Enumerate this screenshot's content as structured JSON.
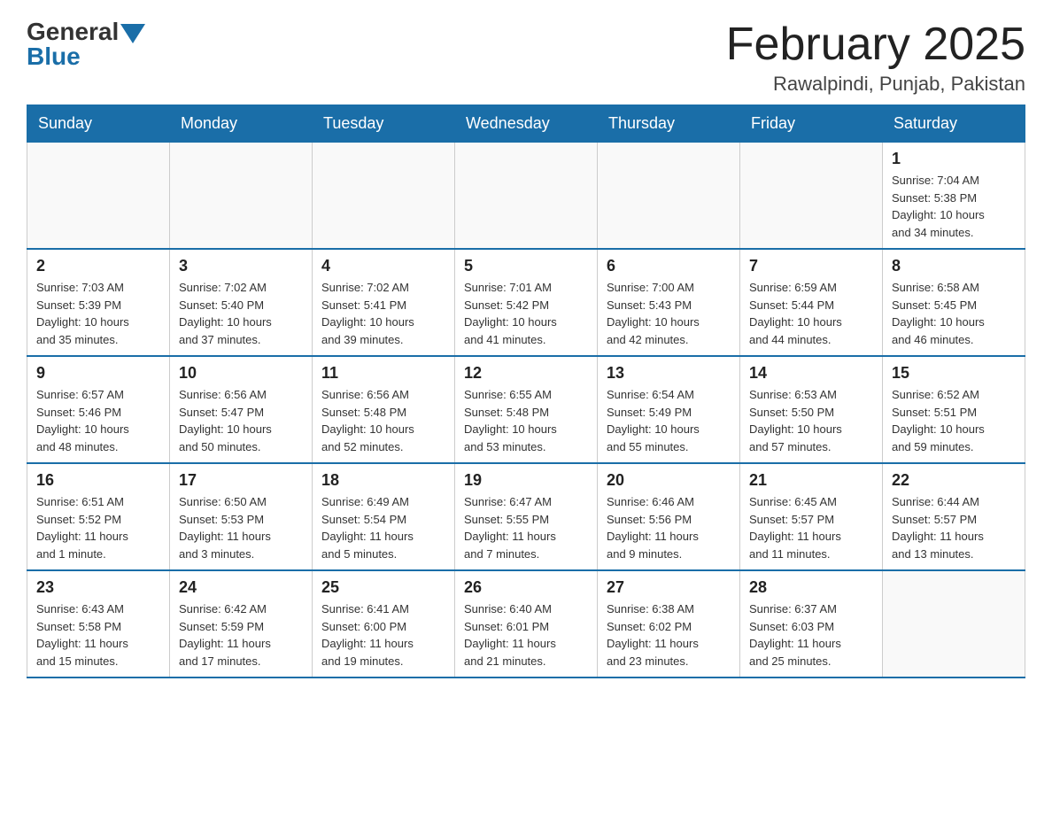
{
  "header": {
    "logo_general": "General",
    "logo_blue": "Blue",
    "month_title": "February 2025",
    "location": "Rawalpindi, Punjab, Pakistan"
  },
  "weekdays": [
    "Sunday",
    "Monday",
    "Tuesday",
    "Wednesday",
    "Thursday",
    "Friday",
    "Saturday"
  ],
  "rows": [
    [
      {
        "day": "",
        "info": ""
      },
      {
        "day": "",
        "info": ""
      },
      {
        "day": "",
        "info": ""
      },
      {
        "day": "",
        "info": ""
      },
      {
        "day": "",
        "info": ""
      },
      {
        "day": "",
        "info": ""
      },
      {
        "day": "1",
        "info": "Sunrise: 7:04 AM\nSunset: 5:38 PM\nDaylight: 10 hours\nand 34 minutes."
      }
    ],
    [
      {
        "day": "2",
        "info": "Sunrise: 7:03 AM\nSunset: 5:39 PM\nDaylight: 10 hours\nand 35 minutes."
      },
      {
        "day": "3",
        "info": "Sunrise: 7:02 AM\nSunset: 5:40 PM\nDaylight: 10 hours\nand 37 minutes."
      },
      {
        "day": "4",
        "info": "Sunrise: 7:02 AM\nSunset: 5:41 PM\nDaylight: 10 hours\nand 39 minutes."
      },
      {
        "day": "5",
        "info": "Sunrise: 7:01 AM\nSunset: 5:42 PM\nDaylight: 10 hours\nand 41 minutes."
      },
      {
        "day": "6",
        "info": "Sunrise: 7:00 AM\nSunset: 5:43 PM\nDaylight: 10 hours\nand 42 minutes."
      },
      {
        "day": "7",
        "info": "Sunrise: 6:59 AM\nSunset: 5:44 PM\nDaylight: 10 hours\nand 44 minutes."
      },
      {
        "day": "8",
        "info": "Sunrise: 6:58 AM\nSunset: 5:45 PM\nDaylight: 10 hours\nand 46 minutes."
      }
    ],
    [
      {
        "day": "9",
        "info": "Sunrise: 6:57 AM\nSunset: 5:46 PM\nDaylight: 10 hours\nand 48 minutes."
      },
      {
        "day": "10",
        "info": "Sunrise: 6:56 AM\nSunset: 5:47 PM\nDaylight: 10 hours\nand 50 minutes."
      },
      {
        "day": "11",
        "info": "Sunrise: 6:56 AM\nSunset: 5:48 PM\nDaylight: 10 hours\nand 52 minutes."
      },
      {
        "day": "12",
        "info": "Sunrise: 6:55 AM\nSunset: 5:48 PM\nDaylight: 10 hours\nand 53 minutes."
      },
      {
        "day": "13",
        "info": "Sunrise: 6:54 AM\nSunset: 5:49 PM\nDaylight: 10 hours\nand 55 minutes."
      },
      {
        "day": "14",
        "info": "Sunrise: 6:53 AM\nSunset: 5:50 PM\nDaylight: 10 hours\nand 57 minutes."
      },
      {
        "day": "15",
        "info": "Sunrise: 6:52 AM\nSunset: 5:51 PM\nDaylight: 10 hours\nand 59 minutes."
      }
    ],
    [
      {
        "day": "16",
        "info": "Sunrise: 6:51 AM\nSunset: 5:52 PM\nDaylight: 11 hours\nand 1 minute."
      },
      {
        "day": "17",
        "info": "Sunrise: 6:50 AM\nSunset: 5:53 PM\nDaylight: 11 hours\nand 3 minutes."
      },
      {
        "day": "18",
        "info": "Sunrise: 6:49 AM\nSunset: 5:54 PM\nDaylight: 11 hours\nand 5 minutes."
      },
      {
        "day": "19",
        "info": "Sunrise: 6:47 AM\nSunset: 5:55 PM\nDaylight: 11 hours\nand 7 minutes."
      },
      {
        "day": "20",
        "info": "Sunrise: 6:46 AM\nSunset: 5:56 PM\nDaylight: 11 hours\nand 9 minutes."
      },
      {
        "day": "21",
        "info": "Sunrise: 6:45 AM\nSunset: 5:57 PM\nDaylight: 11 hours\nand 11 minutes."
      },
      {
        "day": "22",
        "info": "Sunrise: 6:44 AM\nSunset: 5:57 PM\nDaylight: 11 hours\nand 13 minutes."
      }
    ],
    [
      {
        "day": "23",
        "info": "Sunrise: 6:43 AM\nSunset: 5:58 PM\nDaylight: 11 hours\nand 15 minutes."
      },
      {
        "day": "24",
        "info": "Sunrise: 6:42 AM\nSunset: 5:59 PM\nDaylight: 11 hours\nand 17 minutes."
      },
      {
        "day": "25",
        "info": "Sunrise: 6:41 AM\nSunset: 6:00 PM\nDaylight: 11 hours\nand 19 minutes."
      },
      {
        "day": "26",
        "info": "Sunrise: 6:40 AM\nSunset: 6:01 PM\nDaylight: 11 hours\nand 21 minutes."
      },
      {
        "day": "27",
        "info": "Sunrise: 6:38 AM\nSunset: 6:02 PM\nDaylight: 11 hours\nand 23 minutes."
      },
      {
        "day": "28",
        "info": "Sunrise: 6:37 AM\nSunset: 6:03 PM\nDaylight: 11 hours\nand 25 minutes."
      },
      {
        "day": "",
        "info": ""
      }
    ]
  ]
}
